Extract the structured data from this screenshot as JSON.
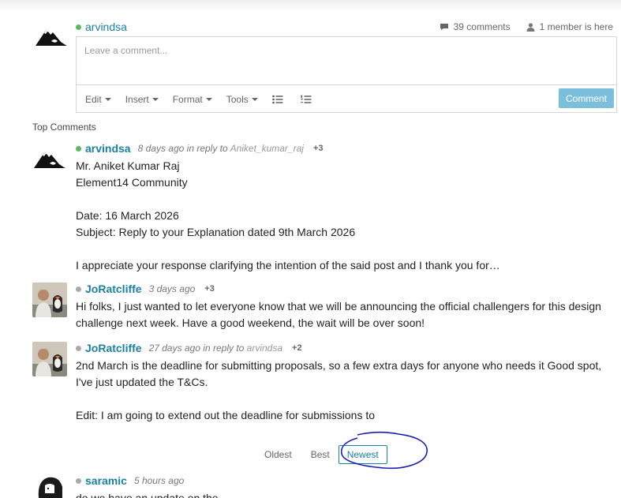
{
  "composer": {
    "username": "arvindsa",
    "placeholder": "Leave a comment...",
    "comments_count": "39 comments",
    "members_here": "1 member is here",
    "toolbar": {
      "edit": "Edit",
      "insert": "Insert",
      "format": "Format",
      "tools": "Tools",
      "comment_button": "Comment"
    }
  },
  "section_title": "Top Comments",
  "comments": [
    {
      "user": "arvindsa",
      "time": "8 days ago",
      "reply_prefix": " in reply to ",
      "reply_to": "Aniket_kumar_raj",
      "score": "+3",
      "text": "Mr. Aniket Kumar Raj\nElement14 Community\n\nDate: 16 March 2026\nSubject: Reply to your Explanation dated 9th March 2026\n\nI appreciate your response clarifying the intention of the said post and I thank you for…"
    },
    {
      "user": "JoRatcliffe",
      "time": "3 days ago",
      "score": "+3",
      "text": "Hi folks, I just wanted to let everyone know that we will be announcing the official challengers for this design challenge next week. Have a good weekend, the wait will be over soon!"
    },
    {
      "user": "JoRatcliffe",
      "time": "27 days ago",
      "reply_prefix": " in reply to ",
      "reply_to": "arvindsa",
      "score": "+2",
      "text": "2nd March is the deadline for submitting proposals, so a few extra days for anyone who needs it  Good spot, I've just updated the T&Cs.\n\nEdit: I am going to extend out the deadline for submissions to"
    },
    {
      "user": "saramic",
      "time": "5 hours ago",
      "text": "do we have an update on the"
    }
  ],
  "sort": {
    "oldest": "Oldest",
    "best": "Best",
    "newest": "Newest"
  },
  "colors": {
    "link": "#1b7fa6",
    "button": "#7bbfdc",
    "annotation": "#1a1fb4",
    "online": "#5cb85c"
  }
}
